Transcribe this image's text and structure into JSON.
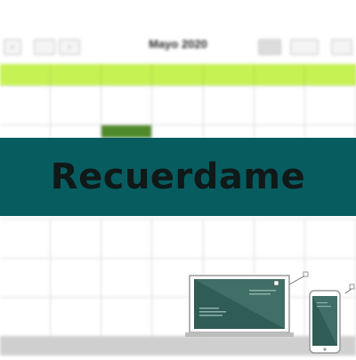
{
  "calendar": {
    "month_title": "Mayo 2020",
    "nav": {
      "prev_label": "‹",
      "next_label": "›",
      "today_label": "",
      "view_labels": [
        "",
        "",
        ""
      ]
    },
    "weekday_headers": [
      "",
      "",
      "",
      "",
      "",
      "",
      ""
    ],
    "weeks": [
      [
        "",
        "",
        "",
        "",
        "",
        "",
        ""
      ],
      [
        "",
        "",
        "",
        "",
        "",
        "",
        ""
      ],
      [
        "",
        "",
        "",
        "",
        "",
        "",
        ""
      ],
      [
        "",
        "",
        "",
        "",
        "",
        "",
        ""
      ],
      [
        "",
        "",
        "",
        "",
        "",
        "",
        ""
      ]
    ],
    "colors": {
      "weekday_bar": "#c6f253",
      "event": "#4e8a2c"
    }
  },
  "banner": {
    "title": "Recuerdame",
    "background": "#075c60",
    "text_color": "#101818"
  },
  "devices": {
    "laptop_icon": "laptop-icon",
    "phone_icon": "smartphone-icon",
    "accent": "#2f5d55"
  }
}
